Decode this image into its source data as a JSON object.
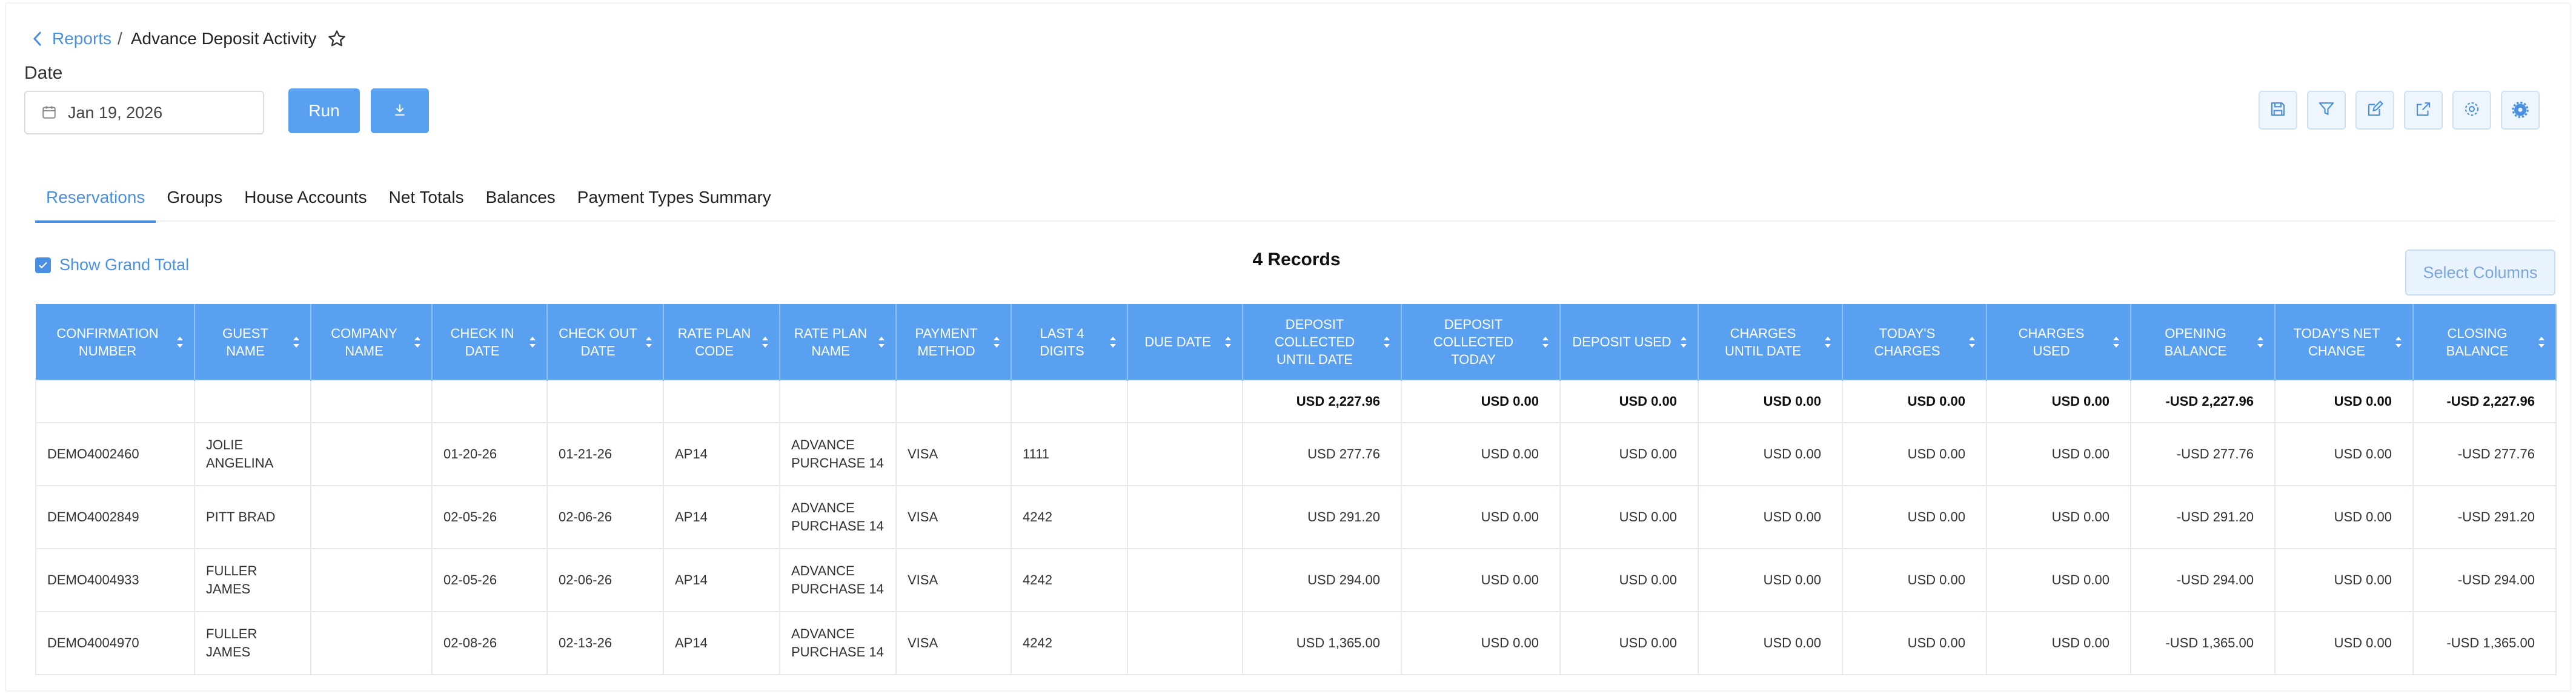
{
  "breadcrumb": {
    "parent": "Reports",
    "separator": "/",
    "current": "Advance Deposit Activity"
  },
  "date_label": "Date",
  "date_value": "Jan 19, 2026",
  "run_label": "Run",
  "toolbar_icons": [
    "save-icon",
    "filter-icon",
    "edit-icon",
    "external-link-icon",
    "gear-icon",
    "gear-badge-icon"
  ],
  "tabs": [
    "Reservations",
    "Groups",
    "House Accounts",
    "Net Totals",
    "Balances",
    "Payment Types Summary"
  ],
  "active_tab": "Reservations",
  "show_grand_total": {
    "label": "Show Grand Total",
    "checked": true
  },
  "records_label": "4 Records",
  "select_columns_label": "Select Columns",
  "colors": {
    "accent": "#4a90e2",
    "header_bg": "#5aa0f0"
  },
  "table": {
    "columns": [
      "CONFIRMATION NUMBER",
      "GUEST NAME",
      "COMPANY NAME",
      "CHECK IN DATE",
      "CHECK OUT DATE",
      "RATE PLAN CODE",
      "RATE PLAN NAME",
      "PAYMENT METHOD",
      "LAST 4 DIGITS",
      "DUE DATE",
      "DEPOSIT COLLECTED UNTIL DATE",
      "DEPOSIT COLLECTED TODAY",
      "DEPOSIT USED",
      "CHARGES UNTIL DATE",
      "TODAY'S CHARGES",
      "CHARGES USED",
      "OPENING BALANCE",
      "TODAY'S NET CHANGE",
      "CLOSING BALANCE"
    ],
    "totals": [
      "",
      "",
      "",
      "",
      "",
      "",
      "",
      "",
      "",
      "",
      "USD 2,227.96",
      "USD 0.00",
      "USD 0.00",
      "USD 0.00",
      "USD 0.00",
      "USD 0.00",
      "-USD 2,227.96",
      "USD 0.00",
      "-USD 2,227.96"
    ],
    "rows": [
      [
        "DEMO4002460",
        "JOLIE ANGELINA",
        "",
        "01-20-26",
        "01-21-26",
        "AP14",
        "ADVANCE PURCHASE 14",
        "VISA",
        "1111",
        "",
        "USD 277.76",
        "USD 0.00",
        "USD 0.00",
        "USD 0.00",
        "USD 0.00",
        "USD 0.00",
        "-USD 277.76",
        "USD 0.00",
        "-USD 277.76"
      ],
      [
        "DEMO4002849",
        "PITT BRAD",
        "",
        "02-05-26",
        "02-06-26",
        "AP14",
        "ADVANCE PURCHASE 14",
        "VISA",
        "4242",
        "",
        "USD 291.20",
        "USD 0.00",
        "USD 0.00",
        "USD 0.00",
        "USD 0.00",
        "USD 0.00",
        "-USD 291.20",
        "USD 0.00",
        "-USD 291.20"
      ],
      [
        "DEMO4004933",
        "FULLER JAMES",
        "",
        "02-05-26",
        "02-06-26",
        "AP14",
        "ADVANCE PURCHASE 14",
        "VISA",
        "4242",
        "",
        "USD 294.00",
        "USD 0.00",
        "USD 0.00",
        "USD 0.00",
        "USD 0.00",
        "USD 0.00",
        "-USD 294.00",
        "USD 0.00",
        "-USD 294.00"
      ],
      [
        "DEMO4004970",
        "FULLER JAMES",
        "",
        "02-08-26",
        "02-13-26",
        "AP14",
        "ADVANCE PURCHASE 14",
        "VISA",
        "4242",
        "",
        "USD 1,365.00",
        "USD 0.00",
        "USD 0.00",
        "USD 0.00",
        "USD 0.00",
        "USD 0.00",
        "-USD 1,365.00",
        "USD 0.00",
        "-USD 1,365.00"
      ]
    ]
  }
}
